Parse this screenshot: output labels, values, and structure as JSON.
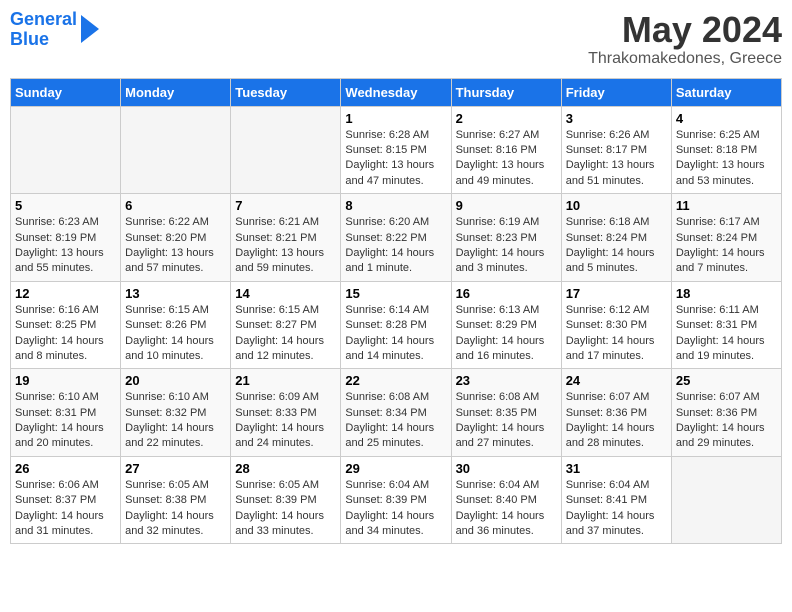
{
  "logo": {
    "line1": "General",
    "line2": "Blue"
  },
  "title": "May 2024",
  "subtitle": "Thrakomakedones, Greece",
  "headers": [
    "Sunday",
    "Monday",
    "Tuesday",
    "Wednesday",
    "Thursday",
    "Friday",
    "Saturday"
  ],
  "weeks": [
    [
      {
        "day": "",
        "sunrise": "",
        "sunset": "",
        "daylight": ""
      },
      {
        "day": "",
        "sunrise": "",
        "sunset": "",
        "daylight": ""
      },
      {
        "day": "",
        "sunrise": "",
        "sunset": "",
        "daylight": ""
      },
      {
        "day": "1",
        "sunrise": "Sunrise: 6:28 AM",
        "sunset": "Sunset: 8:15 PM",
        "daylight": "Daylight: 13 hours and 47 minutes."
      },
      {
        "day": "2",
        "sunrise": "Sunrise: 6:27 AM",
        "sunset": "Sunset: 8:16 PM",
        "daylight": "Daylight: 13 hours and 49 minutes."
      },
      {
        "day": "3",
        "sunrise": "Sunrise: 6:26 AM",
        "sunset": "Sunset: 8:17 PM",
        "daylight": "Daylight: 13 hours and 51 minutes."
      },
      {
        "day": "4",
        "sunrise": "Sunrise: 6:25 AM",
        "sunset": "Sunset: 8:18 PM",
        "daylight": "Daylight: 13 hours and 53 minutes."
      }
    ],
    [
      {
        "day": "5",
        "sunrise": "Sunrise: 6:23 AM",
        "sunset": "Sunset: 8:19 PM",
        "daylight": "Daylight: 13 hours and 55 minutes."
      },
      {
        "day": "6",
        "sunrise": "Sunrise: 6:22 AM",
        "sunset": "Sunset: 8:20 PM",
        "daylight": "Daylight: 13 hours and 57 minutes."
      },
      {
        "day": "7",
        "sunrise": "Sunrise: 6:21 AM",
        "sunset": "Sunset: 8:21 PM",
        "daylight": "Daylight: 13 hours and 59 minutes."
      },
      {
        "day": "8",
        "sunrise": "Sunrise: 6:20 AM",
        "sunset": "Sunset: 8:22 PM",
        "daylight": "Daylight: 14 hours and 1 minute."
      },
      {
        "day": "9",
        "sunrise": "Sunrise: 6:19 AM",
        "sunset": "Sunset: 8:23 PM",
        "daylight": "Daylight: 14 hours and 3 minutes."
      },
      {
        "day": "10",
        "sunrise": "Sunrise: 6:18 AM",
        "sunset": "Sunset: 8:24 PM",
        "daylight": "Daylight: 14 hours and 5 minutes."
      },
      {
        "day": "11",
        "sunrise": "Sunrise: 6:17 AM",
        "sunset": "Sunset: 8:24 PM",
        "daylight": "Daylight: 14 hours and 7 minutes."
      }
    ],
    [
      {
        "day": "12",
        "sunrise": "Sunrise: 6:16 AM",
        "sunset": "Sunset: 8:25 PM",
        "daylight": "Daylight: 14 hours and 8 minutes."
      },
      {
        "day": "13",
        "sunrise": "Sunrise: 6:15 AM",
        "sunset": "Sunset: 8:26 PM",
        "daylight": "Daylight: 14 hours and 10 minutes."
      },
      {
        "day": "14",
        "sunrise": "Sunrise: 6:15 AM",
        "sunset": "Sunset: 8:27 PM",
        "daylight": "Daylight: 14 hours and 12 minutes."
      },
      {
        "day": "15",
        "sunrise": "Sunrise: 6:14 AM",
        "sunset": "Sunset: 8:28 PM",
        "daylight": "Daylight: 14 hours and 14 minutes."
      },
      {
        "day": "16",
        "sunrise": "Sunrise: 6:13 AM",
        "sunset": "Sunset: 8:29 PM",
        "daylight": "Daylight: 14 hours and 16 minutes."
      },
      {
        "day": "17",
        "sunrise": "Sunrise: 6:12 AM",
        "sunset": "Sunset: 8:30 PM",
        "daylight": "Daylight: 14 hours and 17 minutes."
      },
      {
        "day": "18",
        "sunrise": "Sunrise: 6:11 AM",
        "sunset": "Sunset: 8:31 PM",
        "daylight": "Daylight: 14 hours and 19 minutes."
      }
    ],
    [
      {
        "day": "19",
        "sunrise": "Sunrise: 6:10 AM",
        "sunset": "Sunset: 8:31 PM",
        "daylight": "Daylight: 14 hours and 20 minutes."
      },
      {
        "day": "20",
        "sunrise": "Sunrise: 6:10 AM",
        "sunset": "Sunset: 8:32 PM",
        "daylight": "Daylight: 14 hours and 22 minutes."
      },
      {
        "day": "21",
        "sunrise": "Sunrise: 6:09 AM",
        "sunset": "Sunset: 8:33 PM",
        "daylight": "Daylight: 14 hours and 24 minutes."
      },
      {
        "day": "22",
        "sunrise": "Sunrise: 6:08 AM",
        "sunset": "Sunset: 8:34 PM",
        "daylight": "Daylight: 14 hours and 25 minutes."
      },
      {
        "day": "23",
        "sunrise": "Sunrise: 6:08 AM",
        "sunset": "Sunset: 8:35 PM",
        "daylight": "Daylight: 14 hours and 27 minutes."
      },
      {
        "day": "24",
        "sunrise": "Sunrise: 6:07 AM",
        "sunset": "Sunset: 8:36 PM",
        "daylight": "Daylight: 14 hours and 28 minutes."
      },
      {
        "day": "25",
        "sunrise": "Sunrise: 6:07 AM",
        "sunset": "Sunset: 8:36 PM",
        "daylight": "Daylight: 14 hours and 29 minutes."
      }
    ],
    [
      {
        "day": "26",
        "sunrise": "Sunrise: 6:06 AM",
        "sunset": "Sunset: 8:37 PM",
        "daylight": "Daylight: 14 hours and 31 minutes."
      },
      {
        "day": "27",
        "sunrise": "Sunrise: 6:05 AM",
        "sunset": "Sunset: 8:38 PM",
        "daylight": "Daylight: 14 hours and 32 minutes."
      },
      {
        "day": "28",
        "sunrise": "Sunrise: 6:05 AM",
        "sunset": "Sunset: 8:39 PM",
        "daylight": "Daylight: 14 hours and 33 minutes."
      },
      {
        "day": "29",
        "sunrise": "Sunrise: 6:04 AM",
        "sunset": "Sunset: 8:39 PM",
        "daylight": "Daylight: 14 hours and 34 minutes."
      },
      {
        "day": "30",
        "sunrise": "Sunrise: 6:04 AM",
        "sunset": "Sunset: 8:40 PM",
        "daylight": "Daylight: 14 hours and 36 minutes."
      },
      {
        "day": "31",
        "sunrise": "Sunrise: 6:04 AM",
        "sunset": "Sunset: 8:41 PM",
        "daylight": "Daylight: 14 hours and 37 minutes."
      },
      {
        "day": "",
        "sunrise": "",
        "sunset": "",
        "daylight": ""
      }
    ]
  ]
}
